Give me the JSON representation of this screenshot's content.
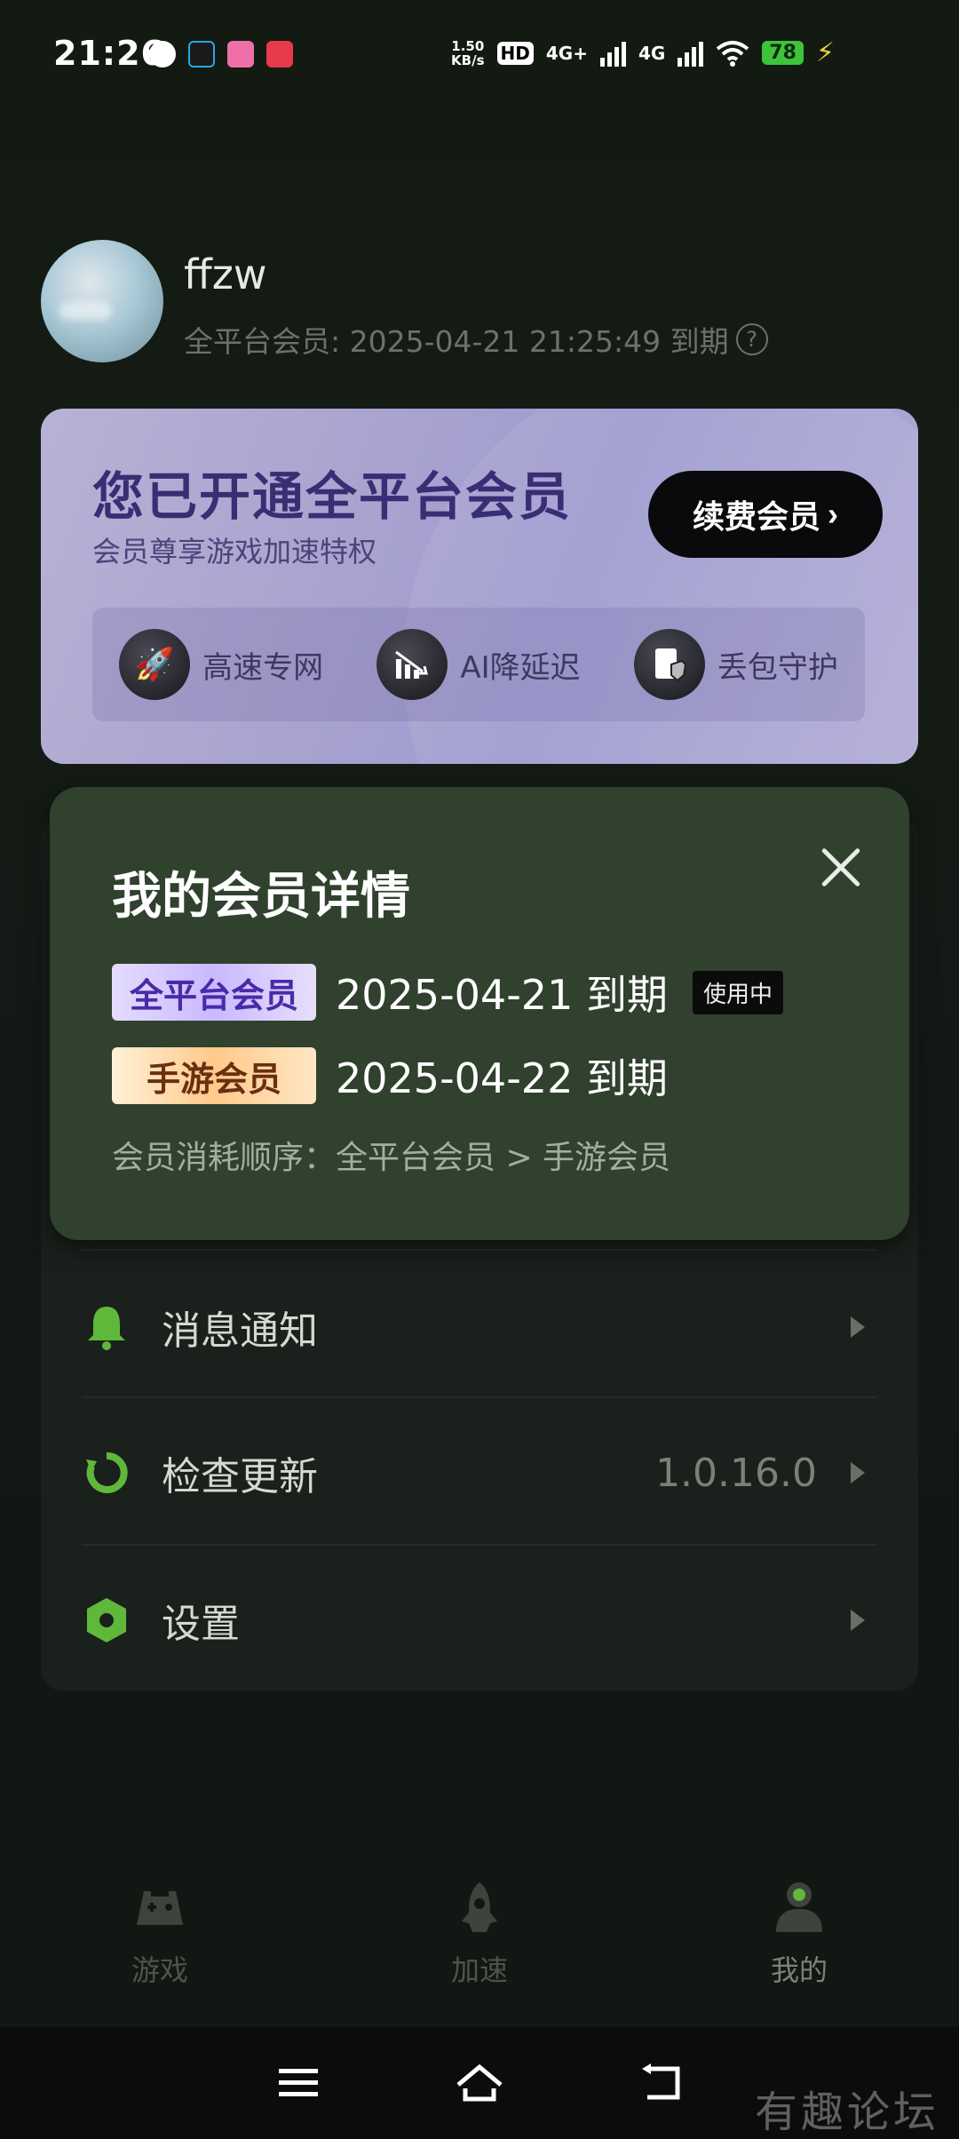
{
  "status_bar": {
    "time": "21:26",
    "net_speed_value": "1.50",
    "net_speed_unit": "KB/s",
    "hd": "HD",
    "sim1": "4G+",
    "sim2": "4G",
    "battery": "78"
  },
  "profile": {
    "username": "ffzw",
    "expire_text": "全平台会员: 2025-04-21 21:25:49 到期",
    "help": "?"
  },
  "member_card": {
    "title": "您已开通全平台会员",
    "subtitle": "会员尊享游戏加速特权",
    "renew_label": "续费会员",
    "features": [
      {
        "label": "高速专网",
        "icon": "rocket-icon"
      },
      {
        "label": "AI降延迟",
        "icon": "latency-chart-icon"
      },
      {
        "label": "丢包守护",
        "icon": "shield-document-icon"
      }
    ]
  },
  "popup": {
    "title": "我的会员详情",
    "tiers": [
      {
        "badge": "全平台会员",
        "date": "2025-04-21 到期",
        "status": "使用中"
      },
      {
        "badge": "手游会员",
        "date": "2025-04-22 到期"
      }
    ],
    "order": "会员消耗顺序：全平台会员 > 手游会员"
  },
  "menu": [
    {
      "label": "消息通知",
      "icon": "bell-icon",
      "value": ""
    },
    {
      "label": "检查更新",
      "icon": "refresh-icon",
      "value": "1.0.16.0"
    },
    {
      "label": "设置",
      "icon": "hexagon-settings-icon",
      "value": ""
    }
  ],
  "bottom_nav": [
    {
      "label": "游戏",
      "icon": "gamepad-icon"
    },
    {
      "label": "加速",
      "icon": "rocket-nav-icon"
    },
    {
      "label": "我的",
      "icon": "user-icon",
      "active": true
    }
  ],
  "watermark": "有趣论坛",
  "colors": {
    "accent_green": "#5fb83a",
    "popup_bg": "#30412e",
    "card_title": "#3a2d74"
  }
}
